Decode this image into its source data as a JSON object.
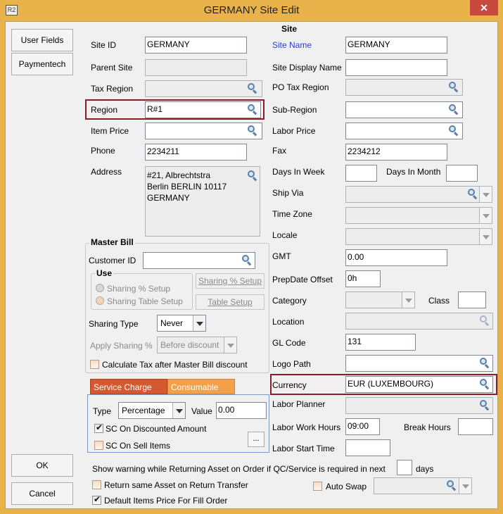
{
  "window": {
    "title": "GERMANY Site Edit",
    "app_icon": "R2",
    "close": "✕"
  },
  "side_buttons": {
    "user_fields": "User Fields",
    "paymentech": "Paymentech",
    "ok": "OK",
    "cancel": "Cancel"
  },
  "section_title": "Site",
  "left": {
    "site_id_label": "Site ID",
    "site_id_value": "GERMANY",
    "parent_site_label": "Parent Site",
    "parent_site_value": "",
    "tax_region_label": "Tax Region",
    "tax_region_value": "",
    "region_label": "Region",
    "region_value": "R#1",
    "item_price_label": "Item Price",
    "item_price_value": "",
    "phone_label": "Phone",
    "phone_value": "2234211",
    "address_label": "Address",
    "address_lines": [
      "#21, Albrechtstra",
      "Berlin BERLIN 10117",
      "GERMANY"
    ]
  },
  "right": {
    "site_name_label": "Site Name",
    "site_name_value": "GERMANY",
    "display_name_label": "Site Display Name",
    "display_name_value": "",
    "po_tax_region_label": "PO Tax Region",
    "po_tax_region_value": "",
    "sub_region_label": "Sub-Region",
    "sub_region_value": "",
    "labor_price_label": "Labor Price",
    "labor_price_value": "",
    "fax_label": "Fax",
    "fax_value": "2234212",
    "days_in_week_label": "Days In Week",
    "days_in_week_value": "",
    "days_in_month_label": "Days In Month",
    "days_in_month_value": "",
    "ship_via_label": "Ship Via",
    "ship_via_value": "",
    "time_zone_label": "Time Zone",
    "time_zone_value": "",
    "locale_label": "Locale",
    "locale_value": "",
    "gmt_label": "GMT",
    "gmt_value": "0.00",
    "prepdate_label": "PrepDate Offset",
    "prepdate_value": "0h",
    "category_label": "Category",
    "category_value": "",
    "class_label": "Class",
    "class_value": "",
    "location_label": "Location",
    "location_value": "",
    "gl_code_label": "GL Code",
    "gl_code_value": "131",
    "logo_path_label": "Logo Path",
    "logo_path_value": "",
    "currency_label": "Currency",
    "currency_value": "EUR (LUXEMBOURG)",
    "labor_planner_label": "Labor Planner",
    "labor_planner_value": "",
    "labor_work_hours_label": "Labor Work Hours",
    "labor_work_hours_value": "09:00",
    "break_hours_label": "Break Hours",
    "break_hours_value": "",
    "labor_start_time_label": "Labor Start Time",
    "labor_start_time_value": ""
  },
  "master_bill": {
    "title": "Master Bill",
    "customer_id_label": "Customer ID",
    "customer_id_value": "",
    "use_title": "Use",
    "sharing_pct_setup_radio": "Sharing % Setup",
    "sharing_table_setup_radio": "Sharing Table Setup",
    "sharing_pct_setup_btn": "Sharing % Setup",
    "table_setup_btn": "Table Setup",
    "sharing_type_label": "Sharing Type",
    "sharing_type_value": "Never",
    "apply_sharing_label": "Apply Sharing %",
    "apply_sharing_value": "Before discount",
    "calc_tax_label": "Calculate Tax after Master Bill discount"
  },
  "service": {
    "tab_service": "Service Charge",
    "tab_consumable": "Consumable",
    "type_label": "Type",
    "type_value": "Percentage",
    "value_label": "Value",
    "value_value": "0.00",
    "sc_discounted_label": "SC On Discounted Amount",
    "sc_sell_label": "SC On Sell Items",
    "more_btn": "..."
  },
  "bottom": {
    "warning_text": "Show warning while Returning Asset on Order if QC/Service is required in next",
    "days_value": "",
    "days_label": "days",
    "return_same_label": "Return same Asset on Return Transfer",
    "auto_swap_label": "Auto Swap",
    "auto_swap_value": "",
    "default_price_label": "Default Items Price For Fill Order"
  }
}
